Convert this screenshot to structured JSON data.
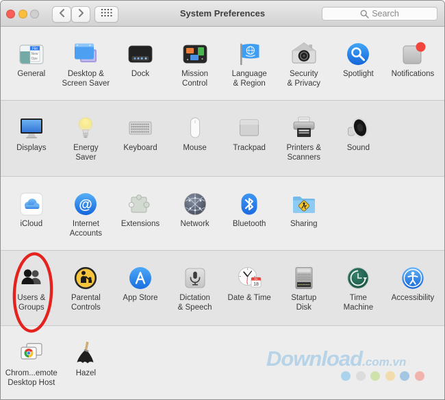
{
  "window": {
    "title": "System Preferences",
    "traffic_lights": [
      {
        "name": "close",
        "color": "#f95f57"
      },
      {
        "name": "minimize",
        "color": "#fbbe3f"
      },
      {
        "name": "zoom-disabled",
        "color": "#cfcfcf"
      }
    ]
  },
  "toolbar": {
    "search_placeholder": "Search"
  },
  "rows": [
    {
      "items": [
        {
          "id": "general",
          "label_lines": [
            "General"
          ]
        },
        {
          "id": "desktop-screensaver",
          "label_lines": [
            "Desktop &",
            "Screen Saver"
          ]
        },
        {
          "id": "dock",
          "label_lines": [
            "Dock"
          ]
        },
        {
          "id": "mission-control",
          "label_lines": [
            "Mission",
            "Control"
          ]
        },
        {
          "id": "language-region",
          "label_lines": [
            "Language",
            "& Region"
          ]
        },
        {
          "id": "security-privacy",
          "label_lines": [
            "Security",
            "& Privacy"
          ]
        },
        {
          "id": "spotlight",
          "label_lines": [
            "Spotlight"
          ]
        },
        {
          "id": "notifications",
          "label_lines": [
            "Notifications"
          ]
        }
      ]
    },
    {
      "items": [
        {
          "id": "displays",
          "label_lines": [
            "Displays"
          ]
        },
        {
          "id": "energy-saver",
          "label_lines": [
            "Energy",
            "Saver"
          ]
        },
        {
          "id": "keyboard",
          "label_lines": [
            "Keyboard"
          ]
        },
        {
          "id": "mouse",
          "label_lines": [
            "Mouse"
          ]
        },
        {
          "id": "trackpad",
          "label_lines": [
            "Trackpad"
          ]
        },
        {
          "id": "printers-scanners",
          "label_lines": [
            "Printers &",
            "Scanners"
          ]
        },
        {
          "id": "sound",
          "label_lines": [
            "Sound"
          ]
        }
      ]
    },
    {
      "items": [
        {
          "id": "icloud",
          "label_lines": [
            "iCloud"
          ]
        },
        {
          "id": "internet-accounts",
          "label_lines": [
            "Internet",
            "Accounts"
          ]
        },
        {
          "id": "extensions",
          "label_lines": [
            "Extensions"
          ]
        },
        {
          "id": "network",
          "label_lines": [
            "Network"
          ]
        },
        {
          "id": "bluetooth",
          "label_lines": [
            "Bluetooth"
          ]
        },
        {
          "id": "sharing",
          "label_lines": [
            "Sharing"
          ]
        }
      ]
    },
    {
      "items": [
        {
          "id": "users-groups",
          "label_lines": [
            "Users &",
            "Groups"
          ]
        },
        {
          "id": "parental-controls",
          "label_lines": [
            "Parental",
            "Controls"
          ]
        },
        {
          "id": "app-store",
          "label_lines": [
            "App Store"
          ]
        },
        {
          "id": "dictation-speech",
          "label_lines": [
            "Dictation",
            "& Speech"
          ]
        },
        {
          "id": "date-time",
          "label_lines": [
            "Date & Time"
          ]
        },
        {
          "id": "startup-disk",
          "label_lines": [
            "Startup",
            "Disk"
          ]
        },
        {
          "id": "time-machine",
          "label_lines": [
            "Time",
            "Machine"
          ]
        },
        {
          "id": "accessibility",
          "label_lines": [
            "Accessibility"
          ]
        }
      ]
    },
    {
      "items": [
        {
          "id": "chrome-remote",
          "label_lines": [
            "Chrom...emote",
            "Desktop Host"
          ]
        },
        {
          "id": "hazel",
          "label_lines": [
            "Hazel"
          ]
        }
      ]
    }
  ],
  "annotation": {
    "shape": "ellipse",
    "color": "#e5231e",
    "target": "users-groups"
  },
  "watermark": {
    "main": "Download",
    "suffix": ".com.vn",
    "color": "#b6d3e8",
    "dot_colors": [
      "#abd4ec",
      "#dcdcdc",
      "#cfe2ab",
      "#f2dcab",
      "#a5c6e3",
      "#f2b3ae"
    ]
  }
}
